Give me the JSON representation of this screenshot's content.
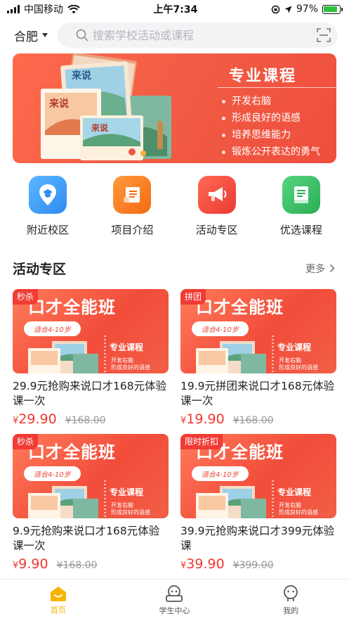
{
  "status_bar": {
    "carrier": "中国移动",
    "time": "上午7:34",
    "battery": "97%"
  },
  "topbar": {
    "city": "合肥",
    "search_placeholder": "搜索学校活动或课程"
  },
  "banner": {
    "title": "专业课程",
    "points": [
      "开发右脑",
      "形成良好的语感",
      "培养思维能力",
      "锻炼公开表达的勇气"
    ],
    "book_title": "来说"
  },
  "quicknav": [
    {
      "label": "附近校区",
      "icon": "location-pin-icon",
      "color": "#3a9bf5"
    },
    {
      "label": "项目介绍",
      "icon": "scroll-icon",
      "color": "#fb7a1d"
    },
    {
      "label": "活动专区",
      "icon": "megaphone-icon",
      "color": "#f24d3d"
    },
    {
      "label": "优选课程",
      "icon": "book-icon",
      "color": "#35c062"
    }
  ],
  "section": {
    "title": "活动专区",
    "more": "更多"
  },
  "cards": [
    {
      "tag": "秒杀",
      "banner_text": "口才全能班",
      "age": "适合4-10岁",
      "course": "专业课程",
      "line1": "开发右脑",
      "line2": "形成良好的语感",
      "title": "29.9元抢购来说口才168元体验课一次",
      "currency": "¥",
      "price": "29.90",
      "original": "¥168.00"
    },
    {
      "tag": "拼团",
      "banner_text": "口才全能班",
      "age": "适合4-10岁",
      "course": "专业课程",
      "line1": "开发右脑",
      "line2": "形成良好的语感",
      "title": "19.9元拼团来说口才168元体验课一次",
      "currency": "¥",
      "price": "19.90",
      "original": "¥168.00"
    },
    {
      "tag": "秒杀",
      "banner_text": "口才全能班",
      "age": "适合4-10岁",
      "course": "专业课程",
      "line1": "开发右脑",
      "line2": "形成良好的语感",
      "title": "9.9元抢购来说口才168元体验课一次",
      "currency": "¥",
      "price": "9.90",
      "original": "¥168.00"
    },
    {
      "tag": "限时折扣",
      "banner_text": "口才全能班",
      "age": "适合4-10岁",
      "course": "专业课程",
      "line1": "开发右脑",
      "line2": "形成良好的语感",
      "title": "39.9元抢购来说口才399元体验课",
      "currency": "¥",
      "price": "39.90",
      "original": "¥399.00"
    }
  ],
  "tabbar": [
    {
      "label": "首页",
      "icon": "home-icon",
      "active": true
    },
    {
      "label": "学生中心",
      "icon": "student-icon",
      "active": false
    },
    {
      "label": "我的",
      "icon": "profile-icon",
      "active": false
    }
  ],
  "colors": {
    "accent": "#f0382e",
    "tab_active": "#f5b300",
    "banner": "#f25d45"
  }
}
